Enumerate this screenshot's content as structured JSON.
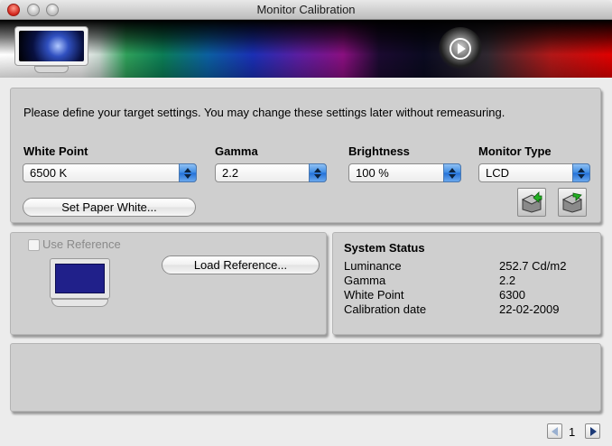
{
  "window": {
    "title": "Monitor Calibration"
  },
  "banner": {
    "left_icon": "monitor-icon",
    "right_icon": "play-logo-icon"
  },
  "target": {
    "intro": "Please define your target settings. You may change these settings later without remeasuring.",
    "white_point": {
      "label": "White Point",
      "value": "6500 K"
    },
    "gamma": {
      "label": "Gamma",
      "value": "2.2"
    },
    "brightness": {
      "label": "Brightness",
      "value": "100 %"
    },
    "monitor_type": {
      "label": "Monitor Type",
      "value": "LCD"
    },
    "set_paper_white_label": "Set Paper White...",
    "folder_icons": [
      "folder-open-icon",
      "folder-save-icon"
    ]
  },
  "reference": {
    "use_reference_label": "Use Reference",
    "use_reference_checked": false,
    "use_reference_enabled": false,
    "load_reference_label": "Load Reference..."
  },
  "status": {
    "title": "System Status",
    "rows": [
      {
        "label": "Luminance",
        "value": "252.7 Cd/m2"
      },
      {
        "label": "Gamma",
        "value": "2.2"
      },
      {
        "label": "White Point",
        "value": "6300"
      },
      {
        "label": "Calibration date",
        "value": "22-02-2009"
      }
    ]
  },
  "pager": {
    "page": "1"
  },
  "colors": {
    "panel": "#cfcfcf",
    "popup_arrow": "#3c8be4",
    "reference_screen": "#20208a"
  }
}
